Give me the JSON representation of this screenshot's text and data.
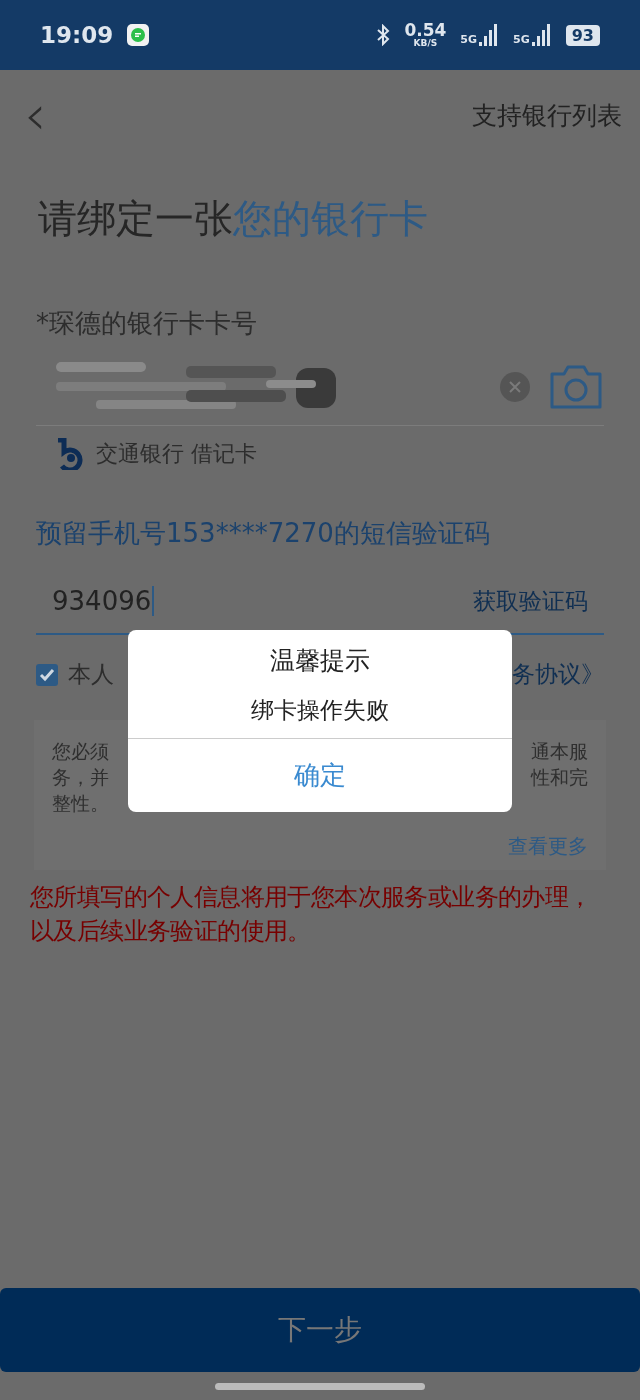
{
  "status_bar": {
    "time": "19:09",
    "speed": "0.54",
    "speed_unit": "KB/S",
    "network_1": "5G",
    "network_2": "5G",
    "battery": "93"
  },
  "nav": {
    "back": "‹",
    "action": "支持银行列表"
  },
  "title": {
    "prefix": "请绑定一张",
    "highlight": "您的银行卡"
  },
  "card_field": {
    "label": "*琛德的银行卡卡号",
    "bank": "交通银行 借记卡"
  },
  "sms_field": {
    "label": "预留手机号153****7270的短信验证码",
    "value": "934096",
    "button": "获取验证码"
  },
  "agreement": {
    "checked": true,
    "text_start": "本人",
    "text_end": "务协议》"
  },
  "info_box": {
    "left_lines": [
      "您必须",
      "务，并",
      "整性。"
    ],
    "right_lines": [
      "通本服",
      "性和完"
    ],
    "more": "查看更多"
  },
  "notice": "您所填写的个人信息将用于您本次服务或业务的办理，以及后续业务验证的使用。",
  "dialog": {
    "title": "温馨提示",
    "message": "绑卡操作失败",
    "button": "确定"
  },
  "next_button": {
    "label": "下一步",
    "disabled": true
  }
}
